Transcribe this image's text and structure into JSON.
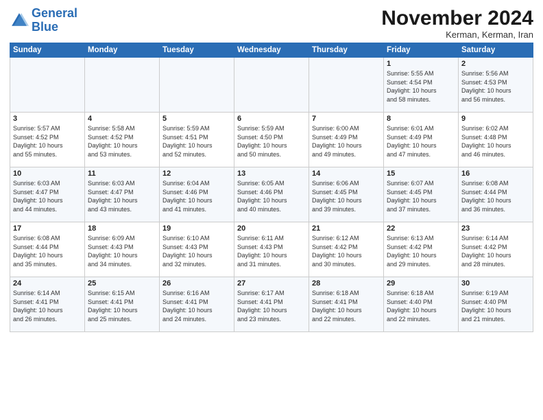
{
  "logo": {
    "line1": "General",
    "line2": "Blue"
  },
  "title": "November 2024",
  "location": "Kerman, Kerman, Iran",
  "weekdays": [
    "Sunday",
    "Monday",
    "Tuesday",
    "Wednesday",
    "Thursday",
    "Friday",
    "Saturday"
  ],
  "weeks": [
    [
      {
        "day": "",
        "info": ""
      },
      {
        "day": "",
        "info": ""
      },
      {
        "day": "",
        "info": ""
      },
      {
        "day": "",
        "info": ""
      },
      {
        "day": "",
        "info": ""
      },
      {
        "day": "1",
        "info": "Sunrise: 5:55 AM\nSunset: 4:54 PM\nDaylight: 10 hours\nand 58 minutes."
      },
      {
        "day": "2",
        "info": "Sunrise: 5:56 AM\nSunset: 4:53 PM\nDaylight: 10 hours\nand 56 minutes."
      }
    ],
    [
      {
        "day": "3",
        "info": "Sunrise: 5:57 AM\nSunset: 4:52 PM\nDaylight: 10 hours\nand 55 minutes."
      },
      {
        "day": "4",
        "info": "Sunrise: 5:58 AM\nSunset: 4:52 PM\nDaylight: 10 hours\nand 53 minutes."
      },
      {
        "day": "5",
        "info": "Sunrise: 5:59 AM\nSunset: 4:51 PM\nDaylight: 10 hours\nand 52 minutes."
      },
      {
        "day": "6",
        "info": "Sunrise: 5:59 AM\nSunset: 4:50 PM\nDaylight: 10 hours\nand 50 minutes."
      },
      {
        "day": "7",
        "info": "Sunrise: 6:00 AM\nSunset: 4:49 PM\nDaylight: 10 hours\nand 49 minutes."
      },
      {
        "day": "8",
        "info": "Sunrise: 6:01 AM\nSunset: 4:49 PM\nDaylight: 10 hours\nand 47 minutes."
      },
      {
        "day": "9",
        "info": "Sunrise: 6:02 AM\nSunset: 4:48 PM\nDaylight: 10 hours\nand 46 minutes."
      }
    ],
    [
      {
        "day": "10",
        "info": "Sunrise: 6:03 AM\nSunset: 4:47 PM\nDaylight: 10 hours\nand 44 minutes."
      },
      {
        "day": "11",
        "info": "Sunrise: 6:03 AM\nSunset: 4:47 PM\nDaylight: 10 hours\nand 43 minutes."
      },
      {
        "day": "12",
        "info": "Sunrise: 6:04 AM\nSunset: 4:46 PM\nDaylight: 10 hours\nand 41 minutes."
      },
      {
        "day": "13",
        "info": "Sunrise: 6:05 AM\nSunset: 4:46 PM\nDaylight: 10 hours\nand 40 minutes."
      },
      {
        "day": "14",
        "info": "Sunrise: 6:06 AM\nSunset: 4:45 PM\nDaylight: 10 hours\nand 39 minutes."
      },
      {
        "day": "15",
        "info": "Sunrise: 6:07 AM\nSunset: 4:45 PM\nDaylight: 10 hours\nand 37 minutes."
      },
      {
        "day": "16",
        "info": "Sunrise: 6:08 AM\nSunset: 4:44 PM\nDaylight: 10 hours\nand 36 minutes."
      }
    ],
    [
      {
        "day": "17",
        "info": "Sunrise: 6:08 AM\nSunset: 4:44 PM\nDaylight: 10 hours\nand 35 minutes."
      },
      {
        "day": "18",
        "info": "Sunrise: 6:09 AM\nSunset: 4:43 PM\nDaylight: 10 hours\nand 34 minutes."
      },
      {
        "day": "19",
        "info": "Sunrise: 6:10 AM\nSunset: 4:43 PM\nDaylight: 10 hours\nand 32 minutes."
      },
      {
        "day": "20",
        "info": "Sunrise: 6:11 AM\nSunset: 4:43 PM\nDaylight: 10 hours\nand 31 minutes."
      },
      {
        "day": "21",
        "info": "Sunrise: 6:12 AM\nSunset: 4:42 PM\nDaylight: 10 hours\nand 30 minutes."
      },
      {
        "day": "22",
        "info": "Sunrise: 6:13 AM\nSunset: 4:42 PM\nDaylight: 10 hours\nand 29 minutes."
      },
      {
        "day": "23",
        "info": "Sunrise: 6:14 AM\nSunset: 4:42 PM\nDaylight: 10 hours\nand 28 minutes."
      }
    ],
    [
      {
        "day": "24",
        "info": "Sunrise: 6:14 AM\nSunset: 4:41 PM\nDaylight: 10 hours\nand 26 minutes."
      },
      {
        "day": "25",
        "info": "Sunrise: 6:15 AM\nSunset: 4:41 PM\nDaylight: 10 hours\nand 25 minutes."
      },
      {
        "day": "26",
        "info": "Sunrise: 6:16 AM\nSunset: 4:41 PM\nDaylight: 10 hours\nand 24 minutes."
      },
      {
        "day": "27",
        "info": "Sunrise: 6:17 AM\nSunset: 4:41 PM\nDaylight: 10 hours\nand 23 minutes."
      },
      {
        "day": "28",
        "info": "Sunrise: 6:18 AM\nSunset: 4:41 PM\nDaylight: 10 hours\nand 22 minutes."
      },
      {
        "day": "29",
        "info": "Sunrise: 6:18 AM\nSunset: 4:40 PM\nDaylight: 10 hours\nand 22 minutes."
      },
      {
        "day": "30",
        "info": "Sunrise: 6:19 AM\nSunset: 4:40 PM\nDaylight: 10 hours\nand 21 minutes."
      }
    ]
  ],
  "colors": {
    "header_bg": "#2a6db5",
    "header_text": "#ffffff",
    "odd_row_bg": "#f0f5fb",
    "even_row_bg": "#ffffff"
  }
}
